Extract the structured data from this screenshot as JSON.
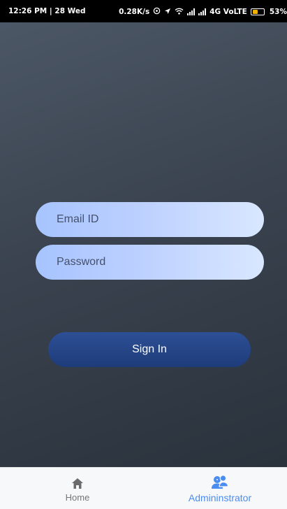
{
  "status_bar": {
    "time": "12:26 PM",
    "separator": "|",
    "date": "28 Wed",
    "speed": "0.28K/s",
    "network": "4G VoLTE",
    "battery": "53%",
    "battery_level": 0.53,
    "battery_color": "#f2b200",
    "icons": [
      "data-saver-icon",
      "location-arrow-icon",
      "wifi-icon",
      "signal-bars-icon",
      "signal-bars-icon",
      "battery-icon"
    ]
  },
  "login": {
    "email_placeholder": "Email ID",
    "password_placeholder": "Password",
    "signin_label": "Sign In"
  },
  "bottom_nav": {
    "items": [
      {
        "label": "Home",
        "icon": "home-icon",
        "active": false
      },
      {
        "label": "Admininstrator",
        "icon": "admin-users-icon",
        "active": true
      }
    ],
    "active_color": "#4a8cf0",
    "inactive_color": "#757575"
  }
}
